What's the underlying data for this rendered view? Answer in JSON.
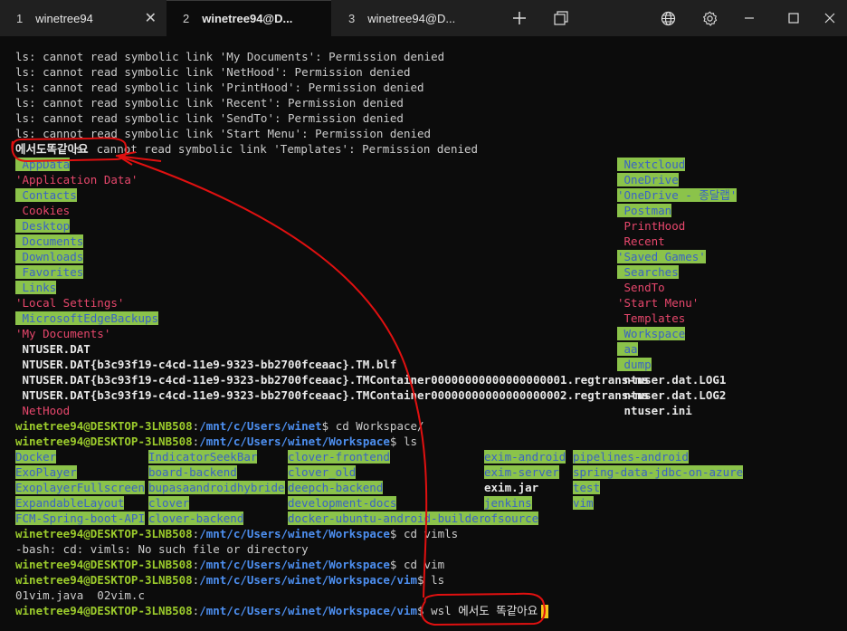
{
  "tabs": [
    {
      "num": "1",
      "label": "winetree94"
    },
    {
      "num": "2",
      "label": "winetree94@D..."
    },
    {
      "num": "3",
      "label": "winetree94@D..."
    }
  ],
  "terminal": {
    "errors": [
      "ls: cannot read symbolic link 'My Documents': Permission denied",
      "ls: cannot read symbolic link 'NetHood': Permission denied",
      "ls: cannot read symbolic link 'PrintHood': Permission denied",
      "ls: cannot read symbolic link 'Recent': Permission denied",
      "ls: cannot read symbolic link 'SendTo': Permission denied",
      "ls: cannot read symbolic link 'Start Menu': Permission denied"
    ],
    "korean_overlay": "에서도똑같아요",
    "templates_error": "ls: cannot read symbolic link 'Templates': Permission denied",
    "home_left": [
      {
        "text": " AppData",
        "cls": "hl"
      },
      {
        "text": "'Application Data'",
        "cls": "r"
      },
      {
        "text": " Contacts",
        "cls": "hl"
      },
      {
        "text": " Cookies",
        "cls": "r"
      },
      {
        "text": " Desktop",
        "cls": "hl"
      },
      {
        "text": " Documents",
        "cls": "hl"
      },
      {
        "text": " Downloads",
        "cls": "hl"
      },
      {
        "text": " Favorites",
        "cls": "hl"
      },
      {
        "text": " Links",
        "cls": "hl"
      },
      {
        "text": "'Local Settings'",
        "cls": "r"
      },
      {
        "text": " MicrosoftEdgeBackups",
        "cls": "hl"
      },
      {
        "text": "'My Documents'",
        "cls": "r"
      },
      {
        "text": " NTUSER.DAT",
        "cls": "w"
      },
      {
        "text": " NTUSER.DAT{b3c93f19-c4cd-11e9-9323-bb2700fceaac}.TM.blf",
        "cls": "w"
      },
      {
        "text": " NTUSER.DAT{b3c93f19-c4cd-11e9-9323-bb2700fceaac}.TMContainer00000000000000000001.regtrans-ms",
        "cls": "w"
      },
      {
        "text": " NTUSER.DAT{b3c93f19-c4cd-11e9-9323-bb2700fceaac}.TMContainer00000000000000000002.regtrans-ms",
        "cls": "w"
      },
      {
        "text": " NetHood",
        "cls": "r"
      }
    ],
    "home_right": [
      {
        "text": " Nextcloud",
        "cls": "hl"
      },
      {
        "text": " OneDrive",
        "cls": "hl"
      },
      {
        "text": "'OneDrive - 종달랩'",
        "cls": "hl"
      },
      {
        "text": " Postman",
        "cls": "hl"
      },
      {
        "text": " PrintHood",
        "cls": "r"
      },
      {
        "text": " Recent",
        "cls": "r"
      },
      {
        "text": "'Saved Games'",
        "cls": "hl"
      },
      {
        "text": " Searches",
        "cls": "hl"
      },
      {
        "text": " SendTo",
        "cls": "r"
      },
      {
        "text": "'Start Menu'",
        "cls": "r"
      },
      {
        "text": " Templates",
        "cls": "r"
      },
      {
        "text": " Workspace",
        "cls": "hl"
      },
      {
        "text": " aa",
        "cls": "hl"
      },
      {
        "text": " dump",
        "cls": "hl"
      },
      {
        "text": " ntuser.dat.LOG1",
        "cls": "w"
      },
      {
        "text": " ntuser.dat.LOG2",
        "cls": "w"
      },
      {
        "text": " ntuser.ini",
        "cls": "w"
      }
    ],
    "prompt_user": "winetree94@DESKTOP-3LNB508",
    "prompt1_path": "/mnt/c/Users/winet",
    "prompt1_cmd": "$ cd Workspace/",
    "prompt2_path": "/mnt/c/Users/winet/Workspace",
    "prompt2_cmd": "$ ls",
    "ws_col1": [
      "Docker",
      "ExoPlayer",
      "ExoplayerFullscreen",
      "ExpandableLayout",
      "FCM-Spring-boot-API"
    ],
    "ws_col2": [
      "IndicatorSeekBar",
      "board-backend",
      "bupasaandroidhybride",
      "clover",
      "clover-backend"
    ],
    "ws_col3": [
      "clover-frontend",
      "clover_old",
      "deepch-backend",
      "development-docs",
      "docker-ubuntu-android-builder"
    ],
    "ws_col4": [
      {
        "text": "exim-android",
        "cls": "hl"
      },
      {
        "text": "exim-server",
        "cls": "hl"
      },
      {
        "text": "exim.jar",
        "cls": "w"
      },
      {
        "text": "jenkins",
        "cls": "hl"
      },
      {
        "text": "ofsource",
        "cls": "hl"
      }
    ],
    "ws_col5": [
      "pipelines-android",
      "spring-data-jdbc-on-azure",
      "test",
      "vim"
    ],
    "prompt3_cmd": "$ cd vimls",
    "bash_error": "-bash: cd: vimls: No such file or directory",
    "prompt4_cmd": "$ cd vim",
    "prompt5_path": "/mnt/c/Users/winet/Workspace/vim",
    "prompt5_cmd": "$ ls",
    "vim_files": "01vim.java  02vim.c",
    "prompt6_cmd": "$ wsl ",
    "prompt6_input": "에서도 똑같아요"
  },
  "colors": {
    "background": "#0c0c0c",
    "tabbar": "#202020",
    "prompt_green": "#9ccc2c",
    "path_blue": "#4d8ff0",
    "dir_highlight": "#8bc34a",
    "symlink_red": "#e7476c",
    "annotation_red": "#e01010",
    "cursor": "#f5c518"
  },
  "icons": [
    "close-icon",
    "plus-icon",
    "duplicate-tab-icon",
    "globe-icon",
    "gear-icon",
    "minimize-icon",
    "maximize-icon",
    "window-close-icon"
  ]
}
